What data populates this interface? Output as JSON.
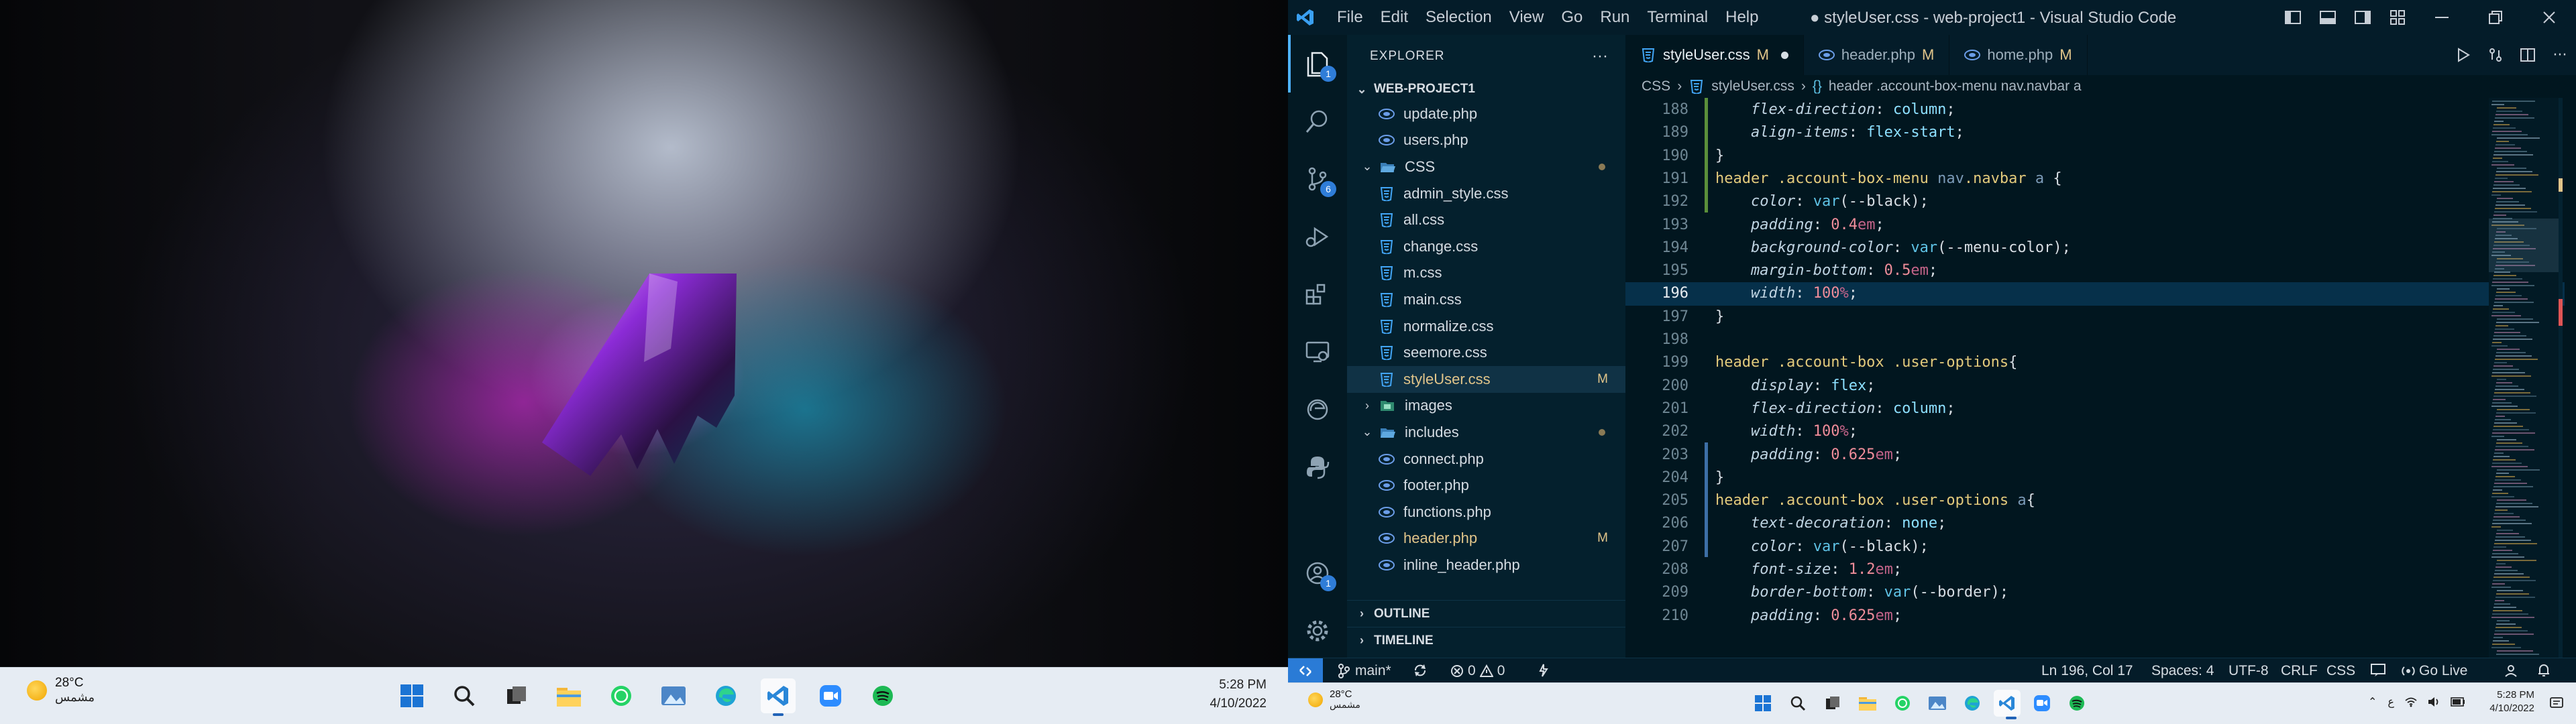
{
  "left_taskbar": {
    "weather_temp": "28°C",
    "weather_condition": "مشمس",
    "time": "5:28 PM",
    "date": "4/10/2022",
    "apps": [
      "windows-start-icon",
      "search-icon",
      "task-view-icon",
      "file-explorer-icon",
      "whatsapp-icon",
      "photos-icon",
      "edge-icon",
      "vscode-icon",
      "zoom-icon",
      "spotify-icon"
    ]
  },
  "vscode": {
    "menu": [
      "File",
      "Edit",
      "Selection",
      "View",
      "Go",
      "Run",
      "Terminal",
      "Help"
    ],
    "title": "● styleUser.css - web-project1 - Visual Studio Code",
    "activity_badges": {
      "explorer": "1",
      "source_control": "6",
      "accounts": "1"
    },
    "explorer": {
      "header": "EXPLORER",
      "project": "WEB-PROJECT1",
      "tree": [
        {
          "name": "update.php",
          "type": "php",
          "depth": 2,
          "status": ""
        },
        {
          "name": "users.php",
          "type": "php",
          "depth": 2,
          "status": ""
        },
        {
          "name": "CSS",
          "type": "folder-open",
          "depth": 1,
          "status": "dot"
        },
        {
          "name": "admin_style.css",
          "type": "css",
          "depth": 2,
          "status": ""
        },
        {
          "name": "all.css",
          "type": "css",
          "depth": 2,
          "status": ""
        },
        {
          "name": "change.css",
          "type": "css",
          "depth": 2,
          "status": ""
        },
        {
          "name": "m.css",
          "type": "css",
          "depth": 2,
          "status": ""
        },
        {
          "name": "main.css",
          "type": "css",
          "depth": 2,
          "status": ""
        },
        {
          "name": "normalize.css",
          "type": "css",
          "depth": 2,
          "status": ""
        },
        {
          "name": "seemore.css",
          "type": "css",
          "depth": 2,
          "status": ""
        },
        {
          "name": "styleUser.css",
          "type": "css",
          "depth": 2,
          "status": "M",
          "selected": true
        },
        {
          "name": "images",
          "type": "folder-closed",
          "depth": 1,
          "status": ""
        },
        {
          "name": "includes",
          "type": "folder-open",
          "depth": 1,
          "status": "dot"
        },
        {
          "name": "connect.php",
          "type": "php",
          "depth": 2,
          "status": ""
        },
        {
          "name": "footer.php",
          "type": "php",
          "depth": 2,
          "status": ""
        },
        {
          "name": "functions.php",
          "type": "php",
          "depth": 2,
          "status": ""
        },
        {
          "name": "header.php",
          "type": "php",
          "depth": 2,
          "status": "M"
        },
        {
          "name": "inline_header.php",
          "type": "php",
          "depth": 2,
          "status": ""
        }
      ],
      "outline": "OUTLINE",
      "timeline": "TIMELINE"
    },
    "tabs": [
      {
        "label": "styleUser.css",
        "mod": "M",
        "active": true,
        "dirty": true,
        "type": "css"
      },
      {
        "label": "header.php",
        "mod": "M",
        "active": false,
        "type": "php"
      },
      {
        "label": "home.php",
        "mod": "M",
        "active": false,
        "type": "php"
      }
    ],
    "breadcrumb": [
      "CSS",
      "styleUser.css",
      "header .account-box-menu nav.navbar a"
    ],
    "code": [
      {
        "n": "188",
        "tokens": [
          [
            "    ",
            "pun"
          ],
          [
            "flex-direction",
            "prop"
          ],
          [
            ": ",
            "pun"
          ],
          [
            "column",
            "val"
          ],
          [
            ";",
            "pun"
          ]
        ]
      },
      {
        "n": "189",
        "tokens": [
          [
            "    ",
            "pun"
          ],
          [
            "align-items",
            "prop"
          ],
          [
            ": ",
            "pun"
          ],
          [
            "flex-start",
            "val"
          ],
          [
            ";",
            "pun"
          ]
        ]
      },
      {
        "n": "190",
        "tokens": [
          [
            "}",
            "pun"
          ]
        ]
      },
      {
        "n": "191",
        "tokens": [
          [
            "header ",
            "sel"
          ],
          [
            ".account-box-menu ",
            "sel"
          ],
          [
            "nav",
            "nav"
          ],
          [
            ".navbar ",
            "sel"
          ],
          [
            "a ",
            "nav"
          ],
          [
            "{",
            "pun"
          ]
        ]
      },
      {
        "n": "192",
        "tokens": [
          [
            "    ",
            "pun"
          ],
          [
            "color",
            "prop"
          ],
          [
            ": ",
            "pun"
          ],
          [
            "var",
            "fn"
          ],
          [
            "(--black);",
            "pun"
          ]
        ]
      },
      {
        "n": "193",
        "tokens": [
          [
            "    ",
            "pun"
          ],
          [
            "padding",
            "prop"
          ],
          [
            ": ",
            "pun"
          ],
          [
            "0.4",
            "num"
          ],
          [
            "em",
            "unit"
          ],
          [
            ";",
            "pun"
          ]
        ]
      },
      {
        "n": "194",
        "tokens": [
          [
            "    ",
            "pun"
          ],
          [
            "background-color",
            "prop"
          ],
          [
            ": ",
            "pun"
          ],
          [
            "var",
            "fn"
          ],
          [
            "(--menu-color);",
            "pun"
          ]
        ]
      },
      {
        "n": "195",
        "tokens": [
          [
            "    ",
            "pun"
          ],
          [
            "margin-bottom",
            "prop"
          ],
          [
            ": ",
            "pun"
          ],
          [
            "0.5",
            "num"
          ],
          [
            "em",
            "unit"
          ],
          [
            ";",
            "pun"
          ]
        ]
      },
      {
        "n": "196",
        "tokens": [
          [
            "    ",
            "pun"
          ],
          [
            "width",
            "prop"
          ],
          [
            ": ",
            "pun"
          ],
          [
            "100",
            "num"
          ],
          [
            "%",
            "unit"
          ],
          [
            ";",
            "pun"
          ]
        ],
        "current": true
      },
      {
        "n": "197",
        "tokens": [
          [
            "}",
            "pun"
          ]
        ]
      },
      {
        "n": "198",
        "tokens": []
      },
      {
        "n": "199",
        "tokens": [
          [
            "header ",
            "sel"
          ],
          [
            ".account-box ",
            "sel"
          ],
          [
            ".user-options",
            "sel"
          ],
          [
            "{",
            "pun"
          ]
        ]
      },
      {
        "n": "200",
        "tokens": [
          [
            "    ",
            "pun"
          ],
          [
            "display",
            "prop"
          ],
          [
            ": ",
            "pun"
          ],
          [
            "flex",
            "val"
          ],
          [
            ";",
            "pun"
          ]
        ]
      },
      {
        "n": "201",
        "tokens": [
          [
            "    ",
            "pun"
          ],
          [
            "flex-direction",
            "prop"
          ],
          [
            ": ",
            "pun"
          ],
          [
            "column",
            "val"
          ],
          [
            ";",
            "pun"
          ]
        ]
      },
      {
        "n": "202",
        "tokens": [
          [
            "    ",
            "pun"
          ],
          [
            "width",
            "prop"
          ],
          [
            ": ",
            "pun"
          ],
          [
            "100",
            "num"
          ],
          [
            "%",
            "unit"
          ],
          [
            ";",
            "pun"
          ]
        ]
      },
      {
        "n": "203",
        "tokens": [
          [
            "    ",
            "pun"
          ],
          [
            "padding",
            "prop"
          ],
          [
            ": ",
            "pun"
          ],
          [
            "0.625",
            "num"
          ],
          [
            "em",
            "unit"
          ],
          [
            ";",
            "pun"
          ]
        ]
      },
      {
        "n": "204",
        "tokens": [
          [
            "}",
            "pun"
          ]
        ]
      },
      {
        "n": "205",
        "tokens": [
          [
            "header ",
            "sel"
          ],
          [
            ".account-box ",
            "sel"
          ],
          [
            ".user-options ",
            "sel"
          ],
          [
            "a",
            "nav"
          ],
          [
            "{",
            "pun"
          ]
        ]
      },
      {
        "n": "206",
        "tokens": [
          [
            "    ",
            "pun"
          ],
          [
            "text-decoration",
            "prop"
          ],
          [
            ": ",
            "pun"
          ],
          [
            "none",
            "val"
          ],
          [
            ";",
            "pun"
          ]
        ]
      },
      {
        "n": "207",
        "tokens": [
          [
            "    ",
            "pun"
          ],
          [
            "color",
            "prop"
          ],
          [
            ": ",
            "pun"
          ],
          [
            "var",
            "fn"
          ],
          [
            "(--black);",
            "pun"
          ]
        ]
      },
      {
        "n": "208",
        "tokens": [
          [
            "    ",
            "pun"
          ],
          [
            "font-size",
            "prop"
          ],
          [
            ": ",
            "pun"
          ],
          [
            "1.2",
            "num"
          ],
          [
            "em",
            "unit"
          ],
          [
            ";",
            "pun"
          ]
        ]
      },
      {
        "n": "209",
        "tokens": [
          [
            "    ",
            "pun"
          ],
          [
            "border-bottom",
            "prop"
          ],
          [
            ": ",
            "pun"
          ],
          [
            "var",
            "fn"
          ],
          [
            "(--border);",
            "pun"
          ]
        ]
      },
      {
        "n": "210",
        "tokens": [
          [
            "    ",
            "pun"
          ],
          [
            "padding",
            "prop"
          ],
          [
            ": ",
            "pun"
          ],
          [
            "0.625",
            "num"
          ],
          [
            "em",
            "unit"
          ],
          [
            ";",
            "pun"
          ]
        ]
      }
    ],
    "status": {
      "branch": "main*",
      "errors": "0",
      "warnings": "0",
      "position": "Ln 196, Col 17",
      "spaces": "Spaces: 4",
      "encoding": "UTF-8",
      "eol": "CRLF",
      "language": "CSS",
      "live": "Go Live"
    }
  },
  "right_taskbar": {
    "weather_temp": "28°C",
    "weather_condition": "مشمس",
    "time": "5:28 PM",
    "date": "4/10/2022",
    "lang": "ع"
  },
  "colors": {
    "accent": "#2a7bd6",
    "modified": "#e1c58a",
    "taskbar": "#e6ecf3"
  }
}
